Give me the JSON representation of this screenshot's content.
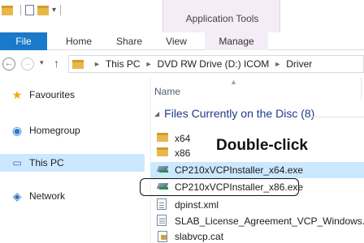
{
  "ribbon": {
    "context_group": "Application Tools",
    "tabs": [
      {
        "label": "File"
      },
      {
        "label": "Home"
      },
      {
        "label": "Share"
      },
      {
        "label": "View"
      },
      {
        "label": "Manage"
      }
    ]
  },
  "address": {
    "path": [
      "This PC",
      "DVD RW Drive (D:) ICOM",
      "Driver"
    ]
  },
  "nav": {
    "items": [
      {
        "label": "Favourites",
        "icon": "star-icon"
      },
      {
        "label": "Homegroup",
        "icon": "homegroup-icon"
      },
      {
        "label": "This PC",
        "icon": "computer-icon",
        "selected": true
      },
      {
        "label": "Network",
        "icon": "network-icon"
      }
    ]
  },
  "content": {
    "column_name": "Name",
    "group_title": "Files Currently on the Disc (8)",
    "files": [
      {
        "name": "x64",
        "type": "folder"
      },
      {
        "name": "x86",
        "type": "folder"
      },
      {
        "name": "CP210xVCPInstaller_x64.exe",
        "type": "exe",
        "selected": true
      },
      {
        "name": "CP210xVCPInstaller_x86.exe",
        "type": "exe",
        "circled": true
      },
      {
        "name": "dpinst.xml",
        "type": "xml"
      },
      {
        "name": "SLAB_License_Agreement_VCP_Windows...",
        "type": "txt"
      },
      {
        "name": "slabvcp.cat",
        "type": "cat"
      }
    ]
  },
  "annotation": {
    "text": "Double-click"
  }
}
